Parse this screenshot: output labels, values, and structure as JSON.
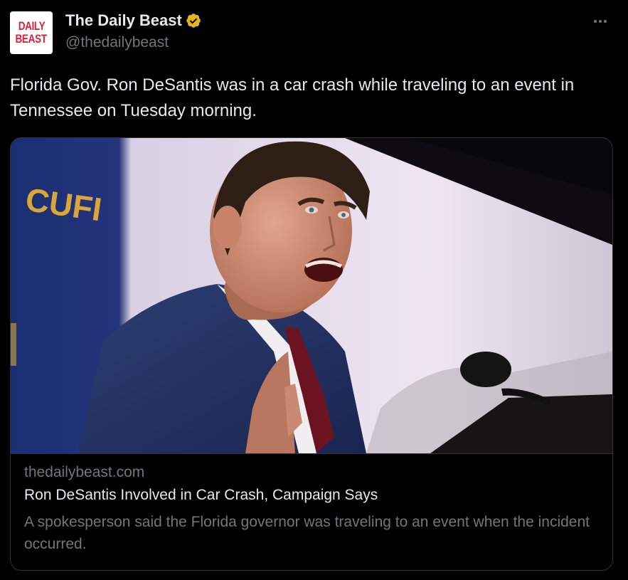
{
  "account": {
    "avatar_text_line1": "DAILY",
    "avatar_text_line2": "BEAST",
    "display_name": "The Daily Beast",
    "handle": "@thedailybeast",
    "verified_badge": "gold-verified-icon"
  },
  "tweet": {
    "text": "Florida Gov. Ron DeSantis was in a car crash while traveling to an event in Tennessee on Tuesday morning."
  },
  "link_card": {
    "domain": "thedailybeast.com",
    "title": "Ron DeSantis Involved in Car Crash, Campaign Says",
    "description": "A spokesperson said the Florida governor was traveling to an event when the incident occurred."
  },
  "colors": {
    "background": "#000000",
    "text_primary": "#e7e9ea",
    "text_secondary": "#71767b",
    "border": "#2f3336",
    "verified_gold": "#e2b719",
    "brand_red": "#e0203a"
  }
}
